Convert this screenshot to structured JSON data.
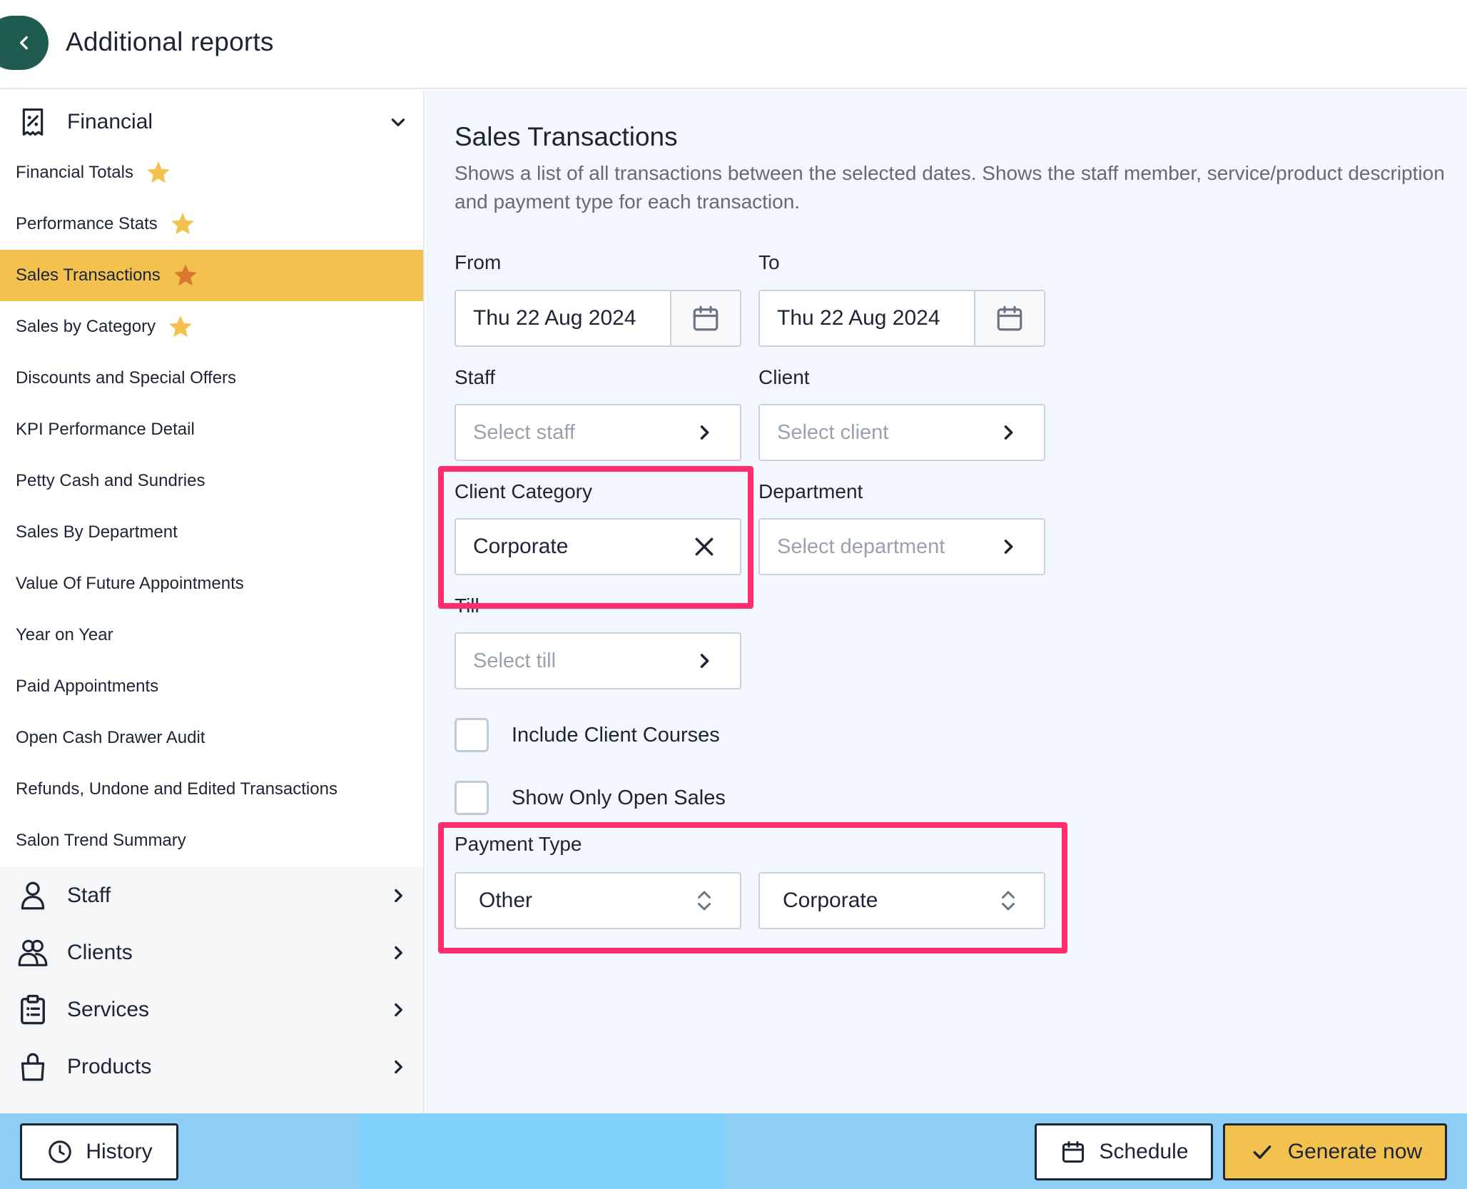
{
  "header": {
    "title": "Additional reports"
  },
  "sidebar": {
    "sections": [
      {
        "label": "Financial",
        "icon": "receipt-percent-icon",
        "expanded": true
      },
      {
        "label": "Staff",
        "icon": "user-icon",
        "expanded": false
      },
      {
        "label": "Clients",
        "icon": "users-icon",
        "expanded": false
      },
      {
        "label": "Services",
        "icon": "clipboard-list-icon",
        "expanded": false
      },
      {
        "label": "Products",
        "icon": "shopping-bag-icon",
        "expanded": false
      }
    ],
    "financial_items": [
      {
        "label": "Financial Totals",
        "starred": true
      },
      {
        "label": "Performance Stats",
        "starred": true
      },
      {
        "label": "Sales Transactions",
        "starred": true,
        "active": true
      },
      {
        "label": "Sales by Category",
        "starred": true
      },
      {
        "label": "Discounts and Special Offers",
        "starred": false
      },
      {
        "label": "KPI Performance Detail",
        "starred": false
      },
      {
        "label": "Petty Cash and Sundries",
        "starred": false
      },
      {
        "label": "Sales By Department",
        "starred": false
      },
      {
        "label": "Value Of Future Appointments",
        "starred": false
      },
      {
        "label": "Year on Year",
        "starred": false
      },
      {
        "label": "Paid Appointments",
        "starred": false
      },
      {
        "label": "Open Cash Drawer Audit",
        "starred": false
      },
      {
        "label": "Refunds, Undone and Edited Transactions",
        "starred": false
      },
      {
        "label": "Salon Trend Summary",
        "starred": false
      }
    ]
  },
  "report": {
    "title": "Sales Transactions",
    "description": "Shows a list of all transactions between the selected dates. Shows the staff member, service/product description and payment type for each transaction.",
    "from": {
      "label": "From",
      "value": "Thu 22 Aug 2024"
    },
    "to": {
      "label": "To",
      "value": "Thu 22 Aug 2024"
    },
    "staff": {
      "label": "Staff",
      "placeholder": "Select staff"
    },
    "client": {
      "label": "Client",
      "placeholder": "Select client"
    },
    "client_category": {
      "label": "Client Category",
      "value": "Corporate"
    },
    "department": {
      "label": "Department",
      "placeholder": "Select department"
    },
    "till": {
      "label": "Till",
      "placeholder": "Select till"
    },
    "include_client_courses": {
      "label": "Include Client Courses",
      "checked": false
    },
    "show_only_open_sales": {
      "label": "Show Only Open Sales",
      "checked": false
    },
    "payment_type": {
      "label": "Payment Type",
      "type_value": "Other",
      "subtype_value": "Corporate"
    }
  },
  "footer": {
    "history_label": "History",
    "schedule_label": "Schedule",
    "generate_label": "Generate now"
  },
  "colors": {
    "accent_yellow": "#f2c14e",
    "star_yellow": "#f2c14e",
    "star_active": "#d9782e",
    "highlight": "#ff2d6f",
    "back_button": "#1f5c4f",
    "footer_bg": "#8ecdf5"
  }
}
